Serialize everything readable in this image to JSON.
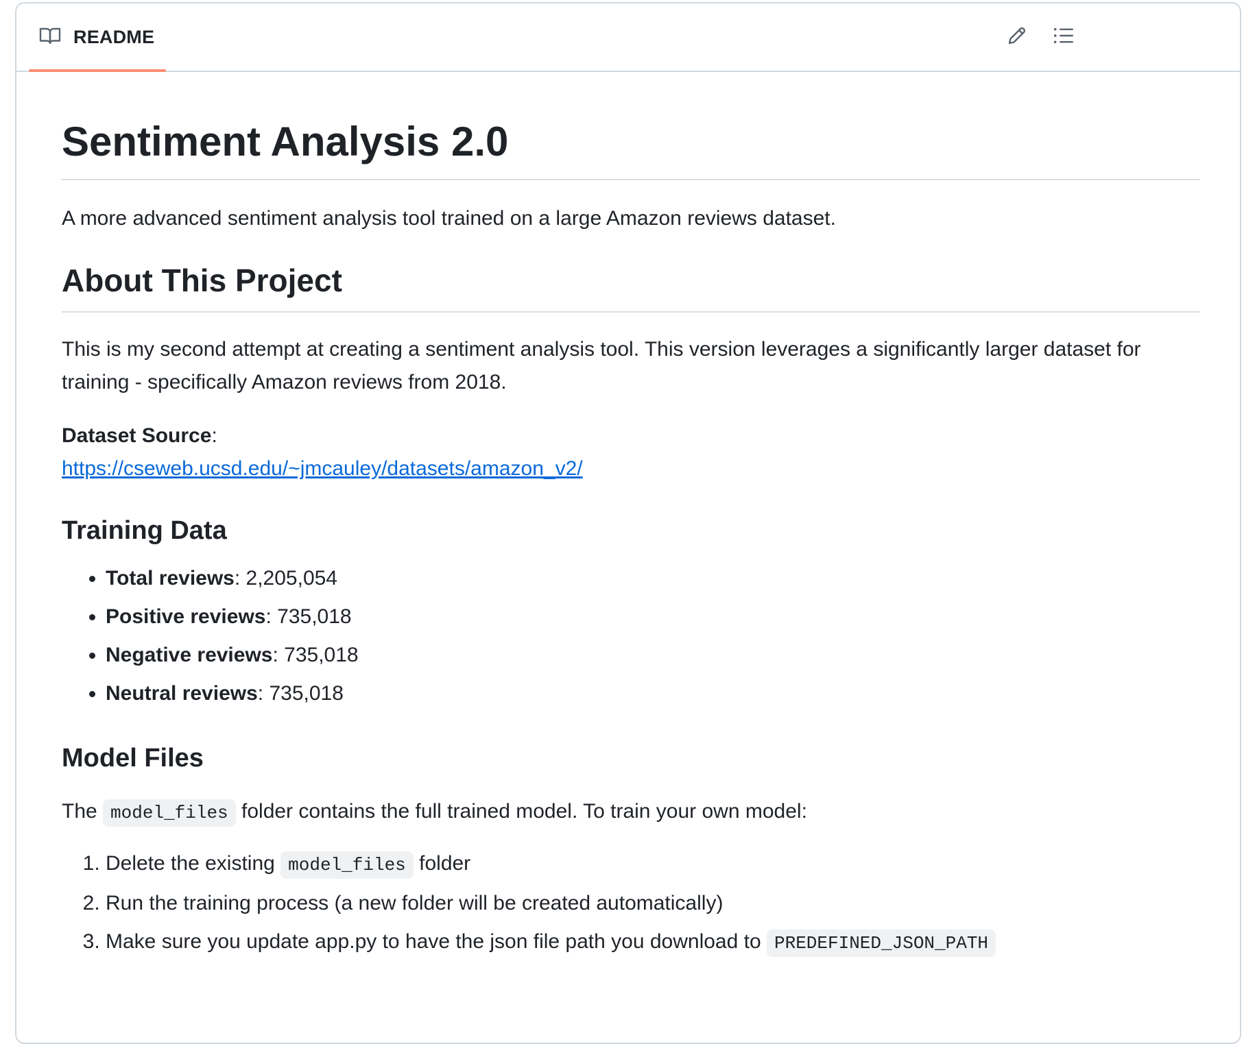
{
  "tab": {
    "label": "README",
    "icon": "book-icon"
  },
  "actions": {
    "edit_icon": "pencil-icon",
    "outline_icon": "list-icon"
  },
  "title": "Sentiment Analysis 2.0",
  "lead": "A more advanced sentiment analysis tool trained on a large Amazon reviews dataset.",
  "about": {
    "heading": "About This Project",
    "text": "This is my second attempt at creating a sentiment analysis tool. This version leverages a significantly larger dataset for training - specifically Amazon reviews from 2018.",
    "source_label": "Dataset Source",
    "source_colon": ":",
    "source_link": "https://cseweb.ucsd.edu/~jmcauley/datasets/amazon_v2/"
  },
  "training": {
    "heading": "Training Data",
    "items": [
      {
        "label": "Total reviews",
        "value": ": 2,205,054"
      },
      {
        "label": "Positive reviews",
        "value": ": 735,018"
      },
      {
        "label": "Negative reviews",
        "value": ": 735,018"
      },
      {
        "label": "Neutral reviews",
        "value": ": 735,018"
      }
    ]
  },
  "model": {
    "heading": "Model Files",
    "intro_before": "The ",
    "intro_code": "model_files",
    "intro_after": " folder contains the full trained model. To train your own model:",
    "steps": [
      {
        "before": "Delete the existing ",
        "code": "model_files",
        "after": " folder"
      },
      {
        "before": "Run the training process (a new folder will be created automatically)",
        "code": "",
        "after": ""
      },
      {
        "before": "Make sure you update app.py to have the json file path you download to ",
        "code": "PREDEFINED_JSON_PATH",
        "after": ""
      }
    ]
  },
  "colors": {
    "accent": "#fd8c73",
    "link": "#0969da",
    "text": "#1f2328",
    "border": "#d1d9e0"
  }
}
